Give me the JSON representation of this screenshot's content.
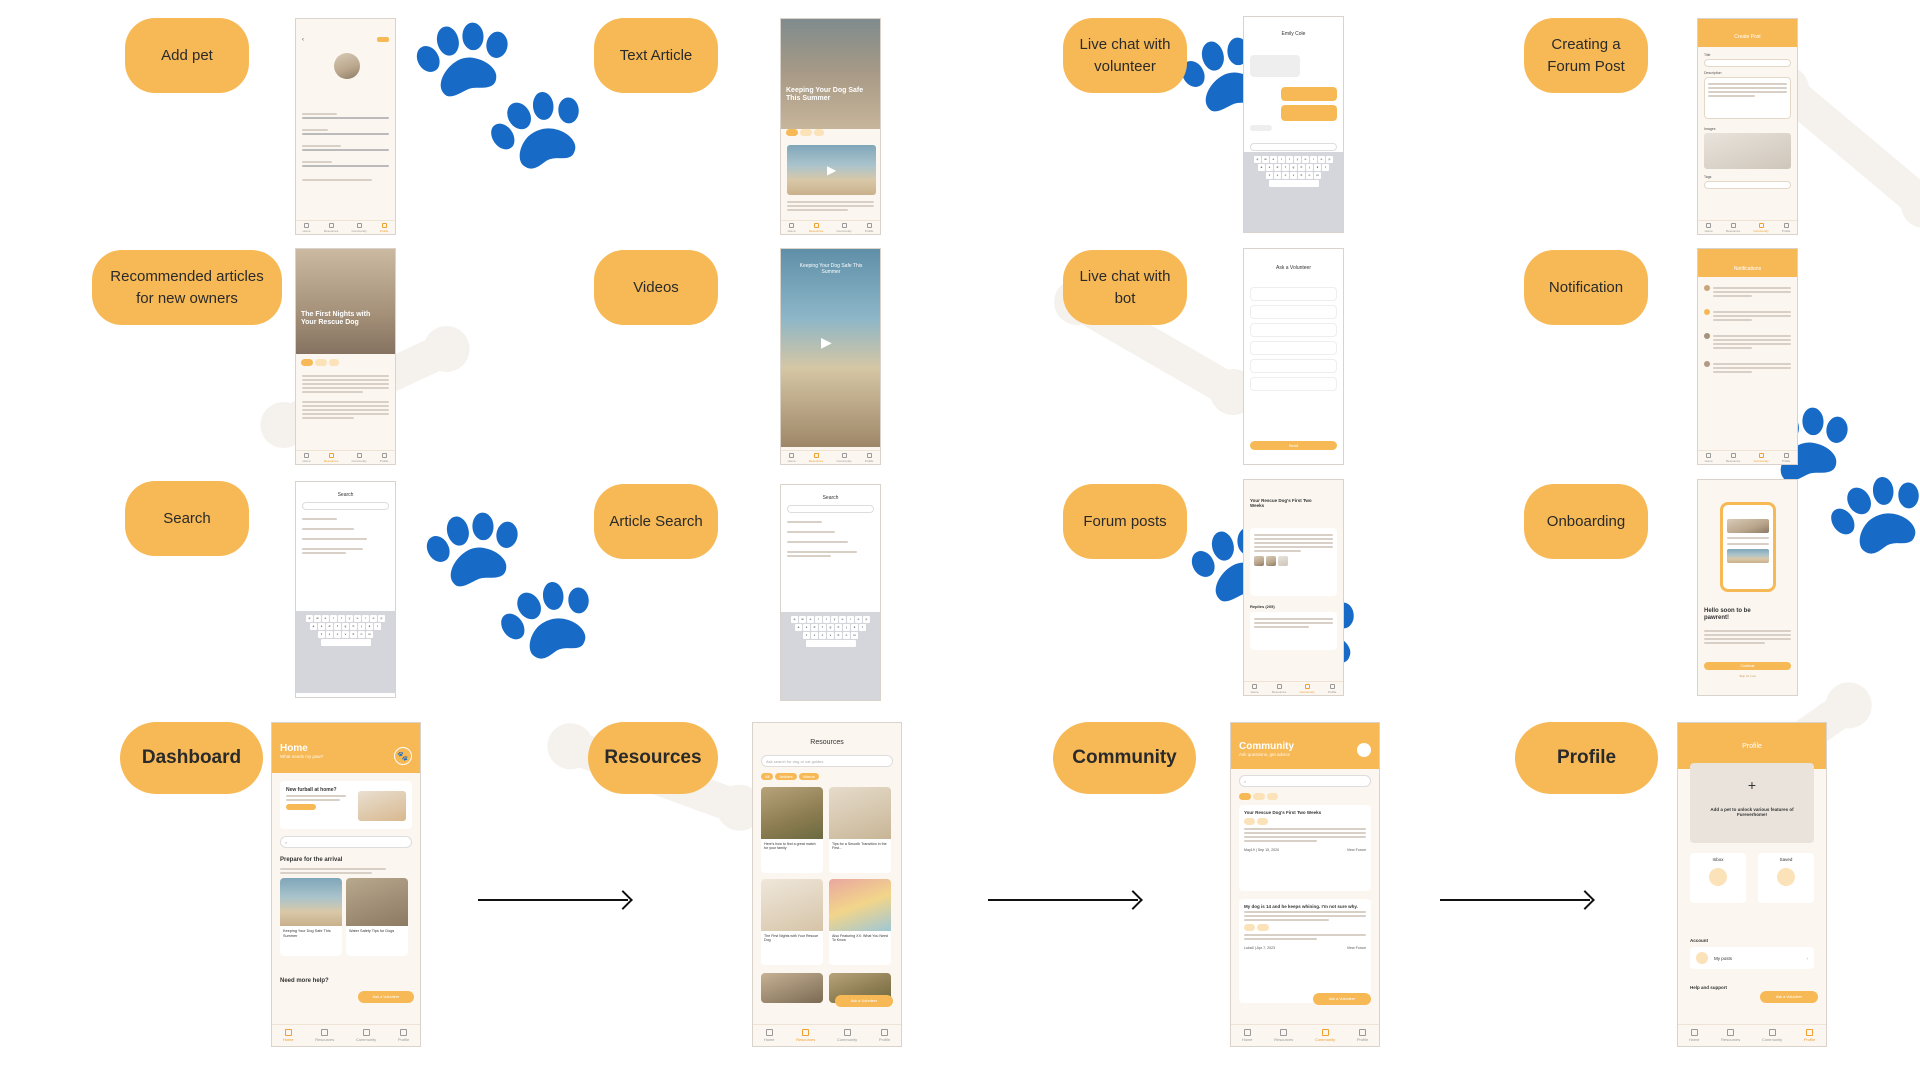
{
  "labels": {
    "add_pet": "Add pet",
    "text_article": "Text Article",
    "live_chat_volunteer": "Live chat with volunteer",
    "creating_forum_post": "Creating a Forum Post",
    "recommended_articles": "Recommended articles for new owners",
    "videos": "Videos",
    "live_chat_bot": "Live chat with bot",
    "notification": "Notification",
    "search": "Search",
    "article_search": "Article Search",
    "forum_posts": "Forum posts",
    "onboarding": "Onboarding",
    "dashboard": "Dashboard",
    "resources": "Resources",
    "community": "Community",
    "profile": "Profile"
  },
  "tabbar": [
    "Home",
    "Resources",
    "Community",
    "Profile"
  ],
  "screens": {
    "text_article": {
      "title": "Keeping Your Dog Safe This Summer"
    },
    "recommended": {
      "title": "The First Nights with Your Rescue Dog"
    },
    "videos": {
      "title": "Keeping Your Dog Safe This Summer"
    },
    "chat_volunteer": {
      "name": "Emily Cole"
    },
    "chat_bot": {
      "title": "Ask a Volunteer",
      "send": "Send"
    },
    "forum_create": {
      "title": "Create Post",
      "title_label": "Title",
      "desc_label": "Description",
      "images_label": "Images",
      "tags_label": "Tags"
    },
    "notification": {
      "title": "Notifications"
    },
    "search": {
      "title": "Search"
    },
    "article_search": {
      "title": "Search"
    },
    "forum_post": {
      "title": "Your Rescue Dog's First Two Weeks",
      "replies": "Replies (205)"
    },
    "onboarding": {
      "title": "Hello soon to be pawrent!",
      "cta": "Continue",
      "skip": "Skip for now"
    },
    "dashboard": {
      "title": "Home",
      "subtitle": "What needs my paw?",
      "new_furball": "New furball at home?",
      "section_prepare": "Prepare for the arrival",
      "card1": "Keeping Your Dog Safe This Summer",
      "card2": "Water Safety Tips for Dogs",
      "need_help": "Need more help?",
      "ask": "Ask a Volunteer"
    },
    "resources": {
      "title": "Resources",
      "search_placeholder": "Ask search for dog or cat guides",
      "chips": [
        "All",
        "Articles",
        "Videos"
      ],
      "articles": [
        "Here's how to find a great match for your family",
        "Tips for a Smooth Transition in the First...",
        "The First Nights with Your Rescue Dog",
        "Also Featuring XX: What You Need To Know"
      ],
      "ask": "Ask a Volunteer"
    },
    "community": {
      "title": "Community",
      "subtitle": "Ask questions, get advice",
      "post1_title": "Your Rescue Dog's First Two Weeks",
      "post1_author": "May19 | Sep 15, 2020",
      "view_forum": "View Forum",
      "post2_title": "My dog is 14 and he keeps whining. I'm not sure why.",
      "post2_author": "Luka0 | Apr 7, 2023",
      "ask": "Ask a Volunteer"
    },
    "profile": {
      "title": "Profile",
      "add_pet": "Add a pet to unlock various features of Fureverhome!",
      "inbox": "Inbox",
      "saved": "Saved",
      "account": "Account",
      "my_posts": "My posts",
      "help": "Help and support",
      "ask": "Ask a Volunteer"
    }
  }
}
